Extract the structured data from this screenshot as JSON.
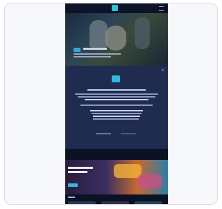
{
  "app": {
    "brand_color": "#2fbbe0",
    "background_color": "#0b1224"
  },
  "header": {
    "logo_icon": "brand-logo-icon",
    "menu_icon": "hamburger-menu-icon"
  },
  "hero": {
    "badge_icon": "play-badge-icon"
  },
  "modal": {
    "close_icon": "close-icon",
    "logo_icon": "brand-logo-icon"
  }
}
